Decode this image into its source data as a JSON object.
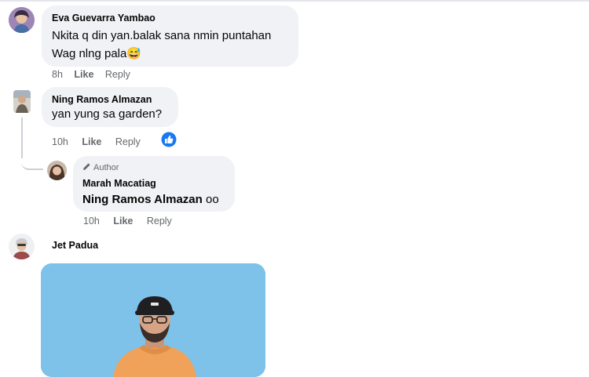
{
  "comments": [
    {
      "author": "Eva Guevarra Yambao",
      "lines": [
        "Nkita q din yan.balak sana nmin puntahan",
        "Wag nlng pala"
      ],
      "emoji": "😅",
      "time": "8h",
      "like_label": "Like",
      "reply_label": "Reply"
    },
    {
      "author": "Ning Ramos Almazan",
      "lines": [
        "yan yung sa garden?"
      ],
      "time": "10h",
      "like_label": "Like",
      "reply_label": "Reply",
      "reaction_icon": "thumbs-up-reaction-icon",
      "reply": {
        "badge": "Author",
        "author": "Marah Macatiag",
        "mention": "Ning Ramos Almazan",
        "text": " oo",
        "time": "10h",
        "like_label": "Like",
        "reply_label": "Reply"
      }
    },
    {
      "author": "Jet Padua",
      "attachment": "photo-attachment"
    }
  ],
  "colors": {
    "bubble": "#f0f2f5",
    "meta": "#65676b",
    "like_blue": "#1877f2",
    "photo_bg": "#7ec2ea"
  }
}
